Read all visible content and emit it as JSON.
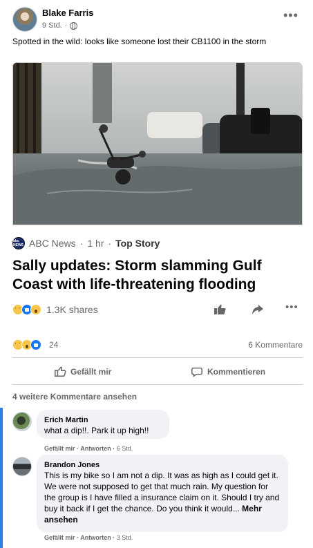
{
  "post": {
    "author": "Blake Farris",
    "time": "9 Std.",
    "caption": "Spotted in the wild: looks like someone lost their CB1100 in the storm",
    "more_icon": "more-horizontal-icon"
  },
  "link_preview": {
    "image_description_icon": "flooded-street-photo",
    "source_logo": "abc-news-logo",
    "source_logo_text": "abc NEWS",
    "source": "ABC News",
    "time": "1 hr",
    "tag": "Top Story",
    "headline": "Sally updates: Storm slamming Gulf Coast with life-threatening flooding",
    "shares": "1.3K shares",
    "reaction_icons": [
      "sad-reaction-icon",
      "like-reaction-icon",
      "wow-reaction-icon"
    ],
    "actions": [
      "like-icon",
      "share-icon",
      "more-horizontal-icon"
    ]
  },
  "engagement": {
    "reaction_icons": [
      "sad-reaction-icon",
      "wow-reaction-icon",
      "like-reaction-icon"
    ],
    "reaction_count": "24",
    "comment_count": "6 Kommentare",
    "like_label": "Gefällt mir",
    "comment_label": "Kommentieren"
  },
  "comments": {
    "more_comments": "4 weitere Kommentare ansehen",
    "items": [
      {
        "author": "Erich Martin",
        "text": "what a dip!!. Park it up high!!",
        "like": "Gefällt mir",
        "reply": "Antworten",
        "time": "6 Std."
      },
      {
        "author": "Brandon Jones",
        "text": "This is my bike so I am not a dip. It was as high as I could get it. We were not supposed to get that much rain. My question for the group is I have filled a insurance claim on it. Should I try and buy it back if I get the chance. Do you think it would...",
        "more": "Mehr ansehen",
        "like": "Gefällt mir",
        "reply": "Antworten",
        "time": "3 Std."
      }
    ]
  },
  "colors": {
    "accent": "#1877f2",
    "secondary_text": "#65676b",
    "comment_bubble": "#f0f2f5",
    "thread_line": "#2f80ed"
  }
}
